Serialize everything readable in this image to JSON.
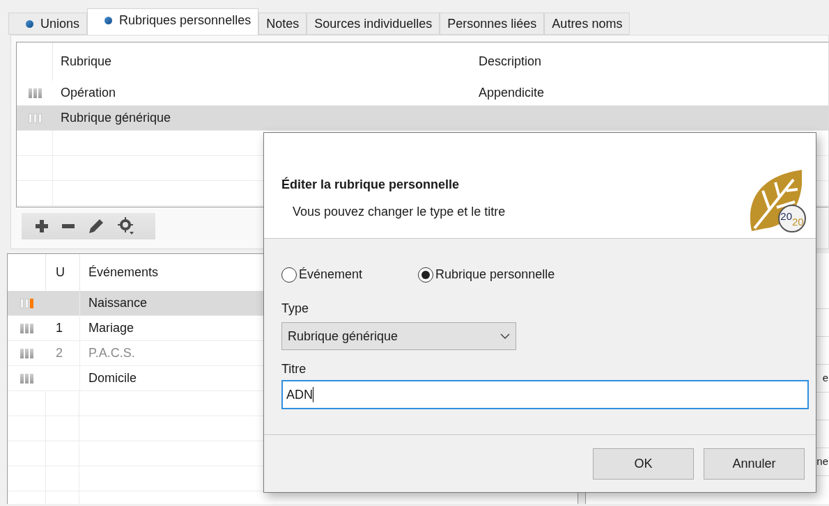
{
  "tabs": [
    {
      "label": "Unions",
      "selected": false,
      "marked": true
    },
    {
      "label": "Rubriques personnelles",
      "selected": true,
      "marked": true
    },
    {
      "label": "Notes",
      "selected": false,
      "marked": false
    },
    {
      "label": "Sources individuelles",
      "selected": false,
      "marked": false
    },
    {
      "label": "Personnes liées",
      "selected": false,
      "marked": false
    },
    {
      "label": "Autres noms",
      "selected": false,
      "marked": false
    }
  ],
  "rubriques": {
    "columns": [
      "Rubrique",
      "Description"
    ],
    "rows": [
      {
        "rubrique": "Opération",
        "description": "Appendicite",
        "selected": false
      },
      {
        "rubrique": "Rubrique générique",
        "selected": true
      }
    ]
  },
  "events": {
    "columns": [
      "U",
      "Événements"
    ],
    "rows": [
      {
        "u": "",
        "name": "Naissance",
        "selected": true,
        "disabled": false
      },
      {
        "u": "1",
        "name": "Mariage",
        "selected": false,
        "disabled": false
      },
      {
        "u": "2",
        "name": "P.A.C.S.",
        "selected": false,
        "disabled": true
      },
      {
        "name": "Domicile",
        "selected": false,
        "disabled": false
      }
    ]
  },
  "right_panel": {
    "rows": [
      {},
      {},
      {},
      {
        "text": "e"
      },
      {},
      {},
      {
        "text": "ne"
      }
    ]
  },
  "dialog": {
    "title": "Éditer la rubrique personnelle",
    "subtitle": "Vous pouvez changer le type et le titre",
    "logo_badge": [
      "20",
      "20"
    ],
    "radios": [
      {
        "label": "Événement",
        "selected": false
      },
      {
        "label": "Rubrique personnelle",
        "selected": true
      }
    ],
    "type_label": "Type",
    "type_value": "Rubrique générique",
    "title_label": "Titre",
    "title_value": "ADN",
    "buttons": [
      "OK",
      "Annuler"
    ]
  }
}
